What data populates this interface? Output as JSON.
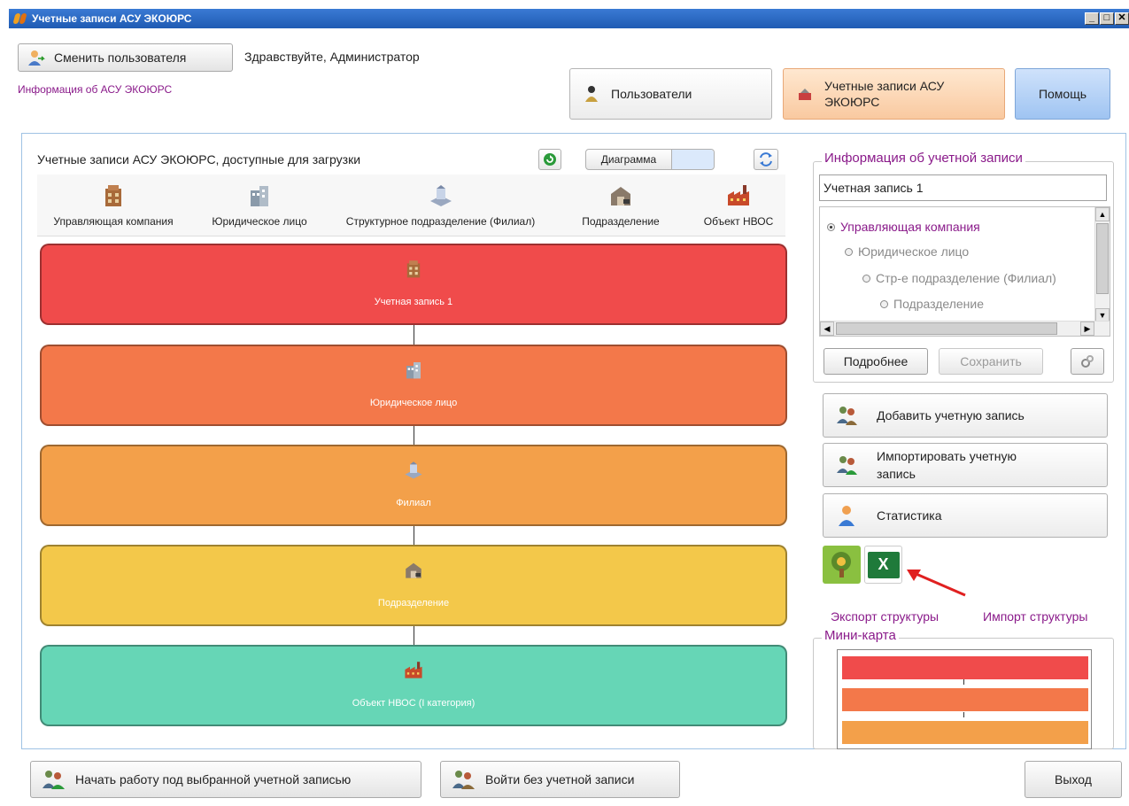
{
  "window": {
    "title": "Учетные записи АСУ ЭКОЮРС",
    "controls": [
      "_",
      "□",
      "✕"
    ]
  },
  "header": {
    "switch_user_label": "Сменить пользователя",
    "greeting": "Здравствуйте, Администратор",
    "info_link": "Информация об АСУ ЭКОЮРС",
    "nav": {
      "users_label": "Пользователи",
      "accounts_label_1": "Учетные записи АСУ",
      "accounts_label_2": "ЭКОЮРС",
      "help_label": "Помощь"
    }
  },
  "left_panel": {
    "title": "Учетные записи АСУ ЭКОЮРС, доступные для загрузки",
    "diagram_toggle_label": "Диаграмма",
    "legend": [
      {
        "label": "Управляющая компания",
        "icon": "building-stack-icon"
      },
      {
        "label": "Юридическое лицо",
        "icon": "office-building-icon"
      },
      {
        "label": "Структурное подразделение (Филиал)",
        "icon": "branch-icon"
      },
      {
        "label": "Подразделение",
        "icon": "warehouse-icon"
      },
      {
        "label": "Объект НВОС",
        "icon": "factory-icon"
      }
    ],
    "nodes": [
      {
        "label": "Учетная запись 1",
        "color": "#f04b4b",
        "icon": "building-stack-icon"
      },
      {
        "label": "Юридическое лицо",
        "color": "#f3784a",
        "icon": "office-building-icon"
      },
      {
        "label": "Филиал",
        "color": "#f3a04a",
        "icon": "branch-icon"
      },
      {
        "label": "Подразделение",
        "color": "#f3c84a",
        "icon": "warehouse-icon"
      },
      {
        "label": "Объект НВОС (I категория)",
        "color": "#66d6b6",
        "icon": "factory-icon"
      }
    ]
  },
  "right_panel": {
    "account_info_title": "Информация об учетной записи",
    "account_name": "Учетная запись 1",
    "tree": [
      {
        "label": "Управляющая компания",
        "selected": true
      },
      {
        "label": "Юридическое лицо",
        "selected": false
      },
      {
        "label": "Стр-е подразделение (Филиал)",
        "selected": false
      },
      {
        "label": "Подразделение",
        "selected": false
      }
    ],
    "details_label": "Подробнее",
    "save_label": "Сохранить",
    "add_account_label": "Добавить учетную запись",
    "import_account_label_1": "Импортировать учетную",
    "import_account_label_2": "запись",
    "statistics_label": "Статистика",
    "export_structure_label": "Экспорт структуры",
    "import_structure_label": "Импорт структуры",
    "excel_tile_text": "X",
    "minimap_title": "Мини-карта",
    "minimap_colors": [
      "#f04b4b",
      "#f3784a",
      "#f3a04a"
    ]
  },
  "footer": {
    "start_label": "Начать работу под выбранной учетной записью",
    "enter_without_label": "Войти без учетной записи",
    "exit_label": "Выход"
  }
}
